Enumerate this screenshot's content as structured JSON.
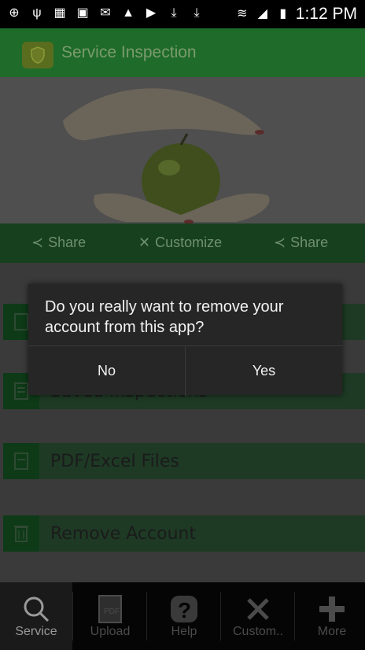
{
  "status_bar": {
    "time": "1:12 PM",
    "icons": [
      "plus-icon",
      "usb-icon",
      "app-icon",
      "image-icon",
      "gmail-icon",
      "warning-icon",
      "youtube-icon",
      "download-icon",
      "download-icon",
      "wifi-icon",
      "signal-icon",
      "battery-icon"
    ]
  },
  "app": {
    "title": "Service Inspection"
  },
  "share_bar": {
    "left": "Share",
    "center": "Customize",
    "right": "Share"
  },
  "menu": [
    {
      "label": "Saved Inspections",
      "icon": "document-icon"
    },
    {
      "label": "PDF/Excel Files",
      "icon": "file-icon"
    },
    {
      "label": "Remove Account",
      "icon": "trash-icon"
    }
  ],
  "dialog": {
    "message": "Do you really want to remove your account from this app?",
    "no": "No",
    "yes": "Yes"
  },
  "bottom_nav": [
    {
      "label": "Service",
      "icon": "search-icon"
    },
    {
      "label": "Upload",
      "icon": "pdf-icon"
    },
    {
      "label": "Help",
      "icon": "question-icon"
    },
    {
      "label": "Custom..",
      "icon": "tools-icon"
    },
    {
      "label": "More",
      "icon": "plus-icon"
    }
  ],
  "colors": {
    "primary": "#1f6b2a",
    "overlay": "#000000"
  }
}
